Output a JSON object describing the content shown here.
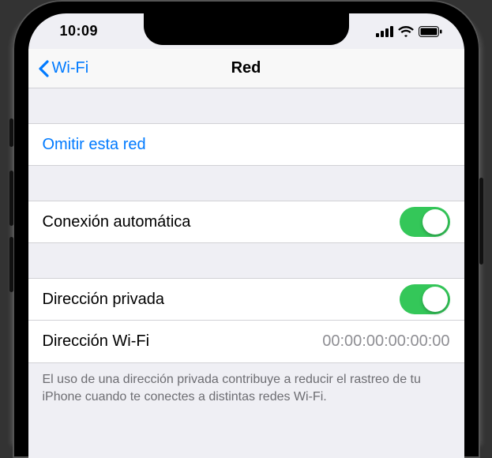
{
  "status": {
    "time": "10:09"
  },
  "nav": {
    "back_label": "Wi-Fi",
    "title": "Red"
  },
  "sections": {
    "forget_label": "Omitir esta red",
    "auto_join_label": "Conexión automática",
    "auto_join_on": true,
    "private_address_label": "Dirección privada",
    "private_address_on": true,
    "wifi_address_label": "Dirección Wi-Fi",
    "wifi_address_value": "00:00:00:00:00:00"
  },
  "footer": "El uso de una dirección privada contribuye a reducir el rastreo de tu iPhone cuando te conectes a distintas redes Wi-Fi."
}
